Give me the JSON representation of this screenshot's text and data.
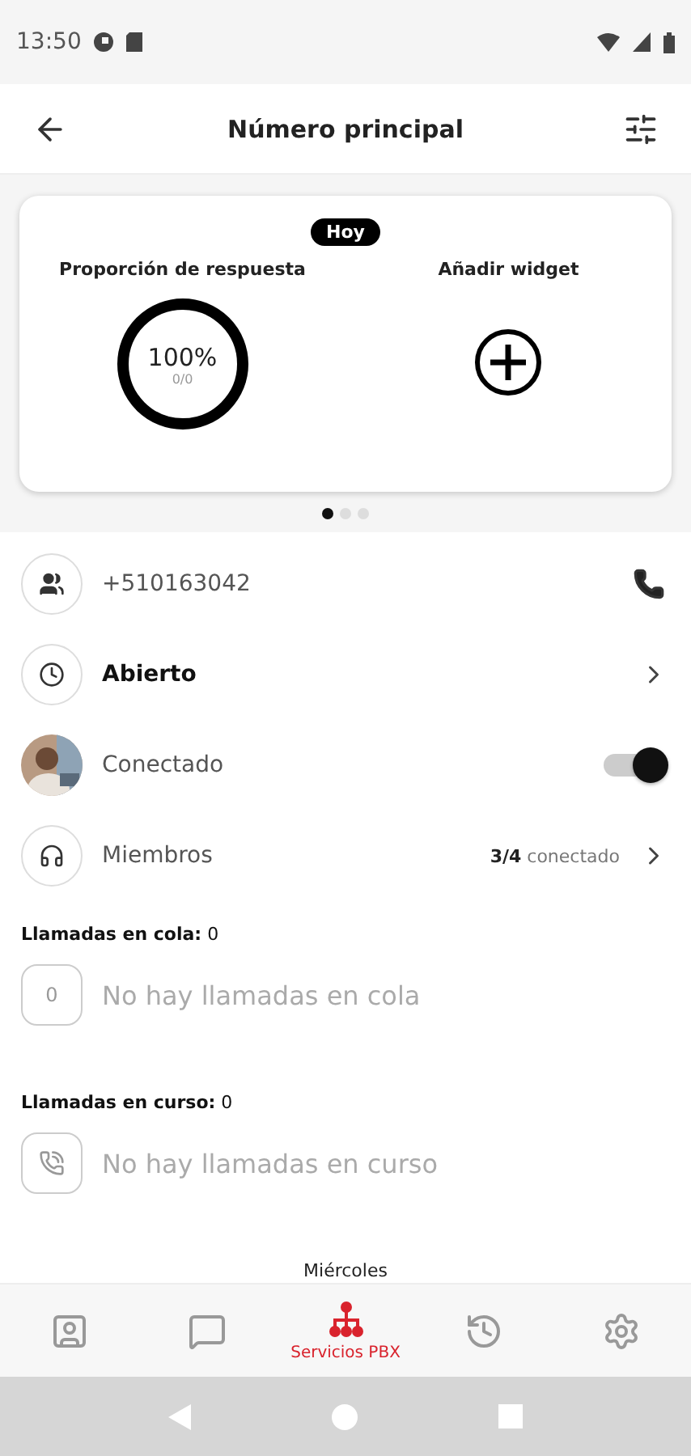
{
  "status_bar": {
    "time": "13:50"
  },
  "header": {
    "title": "Número principal"
  },
  "widgets": {
    "badge": "Hoy",
    "items": [
      {
        "kind": "ratio",
        "title": "Proporción de respuesta",
        "value": "100%",
        "detail": "0/0"
      },
      {
        "kind": "add",
        "title": "Añadir widget"
      }
    ],
    "pager": [
      {
        "selected": true
      },
      {
        "selected": false
      },
      {
        "selected": false
      }
    ]
  },
  "rows": [
    {
      "kind": "phone",
      "label": "+510163042"
    },
    {
      "kind": "hours",
      "label": "Abierto"
    },
    {
      "kind": "status",
      "label": "Conectado",
      "on": true
    },
    {
      "kind": "members",
      "label": "Miembros",
      "count": "3/4",
      "count_label": "conectado"
    }
  ],
  "queues": [
    {
      "kind": "queue",
      "title": "Llamadas en cola:",
      "count": "0",
      "badge": "0",
      "message": "No hay llamadas en cola"
    },
    {
      "kind": "active",
      "title": "Llamadas en curso:",
      "count": "0",
      "message": "No hay llamadas en curso"
    }
  ],
  "date_divider": "Miércoles",
  "nav": [
    {
      "kind": "contacts",
      "selected": false
    },
    {
      "kind": "chat",
      "selected": false
    },
    {
      "kind": "pbx",
      "label": "Servicios PBX",
      "selected": true
    },
    {
      "kind": "history",
      "selected": false
    },
    {
      "kind": "settings",
      "selected": false
    }
  ]
}
